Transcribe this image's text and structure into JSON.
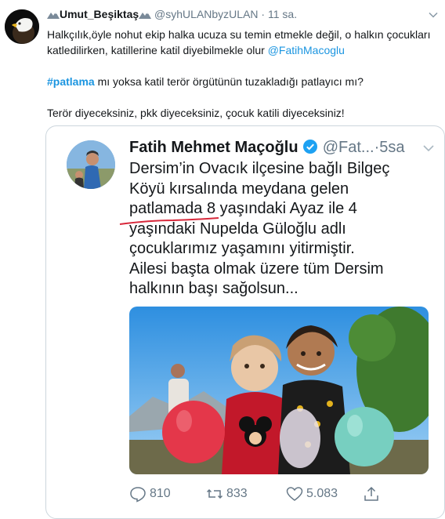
{
  "tweet": {
    "display_name": "Umut_Beşiktaş",
    "handle": "@syhULANbyzULAN",
    "separator": "·",
    "time": "11 sa.",
    "line1_before": "Halkçılık,öyle nohut ekip halka ucuza su temin etmekle değil, o halkın çocukları katledilirken, katillerine katil diyebilmekle olur ",
    "mention": "@FatihMacoglu",
    "hashtag": "#patlama",
    "line2_after": " mı yoksa katil terör örgütünün tuzakladığı patlayıcı mı?",
    "line3": "Terör diyeceksiniz, pkk diyeceksiniz, çocuk katili diyeceksiniz!"
  },
  "quoted": {
    "display_name": "Fatih Mehmet Maçoğlu",
    "handle": "@Fat...",
    "separator": "·",
    "time": "5sa",
    "lines": [
      "Dersim’in Ovacık ilçesine bağlı Bilgeç",
      "Köyü kırsalında meydana gelen",
      "patlamada 8 yaşındaki Ayaz ile 4",
      "yaşındaki Nupelda Güloğlu adlı",
      "çocuklarımız yaşamını yitirmiştir.",
      " Ailesi başta olmak üzere tüm Dersim",
      "halkının başı sağolsun..."
    ],
    "stats": {
      "replies": "810",
      "retweets": "833",
      "likes": "5.083"
    }
  },
  "icons": {
    "reply": "reply-icon",
    "retweet": "retweet-icon",
    "like": "heart-icon",
    "share": "share-icon",
    "verified": "verified-badge-icon",
    "caret": "chevron-down-icon",
    "name_decoration": "mountain-icon"
  },
  "colors": {
    "link": "#1b95e0",
    "muted": "#657786",
    "border": "#ccd6dd",
    "underline_annotation": "#d8283b"
  }
}
